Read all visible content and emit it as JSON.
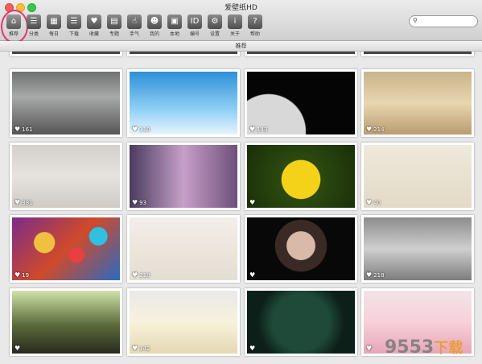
{
  "window": {
    "title": "爱壁纸HD"
  },
  "toolbar": [
    {
      "id": "home",
      "label": "推荐",
      "glyph": "⌂",
      "icon": "home-icon"
    },
    {
      "id": "category",
      "label": "分类",
      "glyph": "☰",
      "icon": "list-icon"
    },
    {
      "id": "daily",
      "label": "每日",
      "glyph": "▦",
      "icon": "calendar-icon"
    },
    {
      "id": "download",
      "label": "下载",
      "glyph": "☰",
      "icon": "download-list-icon"
    },
    {
      "id": "favorite",
      "label": "收藏",
      "glyph": "♥",
      "icon": "heart-icon"
    },
    {
      "id": "topic",
      "label": "专题",
      "glyph": "▤",
      "icon": "topic-icon"
    },
    {
      "id": "gesture",
      "label": "手气",
      "glyph": "☝",
      "icon": "hand-icon"
    },
    {
      "id": "mine",
      "label": "我的",
      "glyph": "☻",
      "icon": "user-icon"
    },
    {
      "id": "local",
      "label": "本地",
      "glyph": "▣",
      "icon": "local-icon"
    },
    {
      "id": "number",
      "label": "编号",
      "glyph": "ID",
      "icon": "id-icon"
    },
    {
      "id": "settings",
      "label": "设置",
      "glyph": "⚙",
      "icon": "gear-icon"
    },
    {
      "id": "about",
      "label": "关于",
      "glyph": "i",
      "icon": "info-icon"
    },
    {
      "id": "help",
      "label": "帮助",
      "glyph": "?",
      "icon": "help-icon"
    }
  ],
  "search": {
    "placeholder": ""
  },
  "section": {
    "title": "推荐"
  },
  "wallpapers": [
    {
      "likes": "161",
      "bg": "linear-gradient(#6f7272,#a7aaa8 40%,#555 100%)"
    },
    {
      "likes": "110",
      "bg": "linear-gradient(#2e8fd8,#8fd0f5 60%,#e8f4fb)"
    },
    {
      "likes": "143",
      "bg": "radial-gradient(circle at 20% 95%,#d8d8d8 0 35%,#050505 36%)"
    },
    {
      "likes": "214",
      "bg": "linear-gradient(#c9b48a,#e8d6b0 50%,#b89c70)"
    },
    {
      "likes": "381",
      "bg": "linear-gradient(#d4d0cb,#e6e3df 50%,#cfcac4)"
    },
    {
      "likes": "93",
      "bg": "linear-gradient(90deg,#4a3b5e,#c7a0c8 50%,#6d4f7a)"
    },
    {
      "likes": "",
      "bg": "radial-gradient(circle at 50% 55%,#f5d21a 0 30%,#2b4a10 31%,#1a2e08)"
    },
    {
      "likes": "40",
      "bg": "linear-gradient(#efe9dc,#e3dac6)"
    },
    {
      "likes": "19",
      "bg": "radial-gradient(circle at 30% 40%,#f0c040 0 12%,transparent 13%),radial-gradient(circle at 60% 60%,#e84040 0 10%,transparent 11%),radial-gradient(circle at 80% 30%,#30c0e0 0 9%,transparent 10%),linear-gradient(135deg,#7a2c8a,#d04a2a 50%,#2a6ac0)"
    },
    {
      "likes": "218",
      "bg": "linear-gradient(#f3eee8,#e4ddd2)"
    },
    {
      "likes": "",
      "bg": "radial-gradient(circle at 50% 45%,#d9b9a8 0 22%,#3a2a25 23% 40%,#080808 41%)"
    },
    {
      "likes": "218",
      "bg": "linear-gradient(#8c8c8c,#cfcfcf 50%,#7d7d7d)"
    },
    {
      "likes": "",
      "bg": "linear-gradient(#cfe2a8,#5a6a3a 55%,#2a2a1e)"
    },
    {
      "likes": "142",
      "bg": "linear-gradient(#e9e9e9,#f7f2dc 50%,#e5d8b5)"
    },
    {
      "likes": "",
      "bg": "radial-gradient(circle at 50% 50%,#1f4a3a 0 45%,#0c1f18 70%)"
    },
    {
      "likes": "",
      "bg": "linear-gradient(#f2e4e8,#f8d0da 50%,#e6a6b8)"
    }
  ],
  "watermark": {
    "main": "9553",
    "sub": "下载"
  }
}
